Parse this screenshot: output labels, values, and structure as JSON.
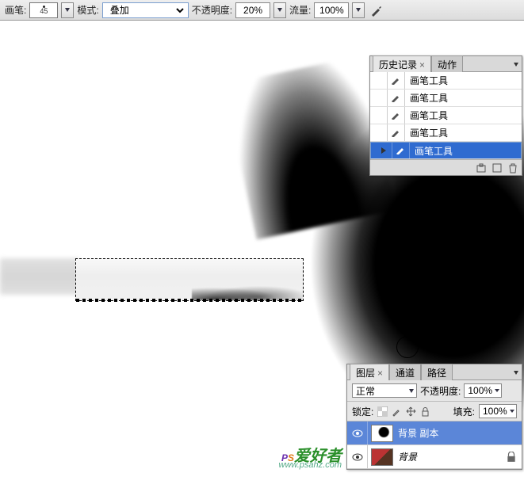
{
  "optionBar": {
    "brushLabel": "画笔:",
    "brushSize": "45",
    "modeLabel": "模式:",
    "modeValue": "叠加",
    "opacityLabel": "不透明度:",
    "opacityValue": "20%",
    "flowLabel": "流量:",
    "flowValue": "100%"
  },
  "historyPanel": {
    "tabs": [
      "历史记录",
      "动作"
    ],
    "activeTab": 0,
    "items": [
      {
        "label": "画笔工具",
        "selected": false
      },
      {
        "label": "画笔工具",
        "selected": false
      },
      {
        "label": "画笔工具",
        "selected": false
      },
      {
        "label": "画笔工具",
        "selected": false
      },
      {
        "label": "画笔工具",
        "selected": true
      }
    ]
  },
  "layersPanel": {
    "tabs": [
      "图层",
      "通道",
      "路径"
    ],
    "activeTab": 0,
    "blendMode": "正常",
    "opacityLabel": "不透明度:",
    "opacityValue": "100%",
    "lockLabel": "锁定:",
    "fillLabel": "填充:",
    "fillValue": "100%",
    "layers": [
      {
        "name": "背景 副本",
        "selected": true,
        "locked": false,
        "thumb": "bg",
        "italic": false
      },
      {
        "name": "背景",
        "selected": false,
        "locked": true,
        "thumb": "img",
        "italic": true
      }
    ]
  },
  "watermark": {
    "p": "P",
    "s": "S",
    "txt": "爱好者",
    "url": "www.psahz.com"
  }
}
